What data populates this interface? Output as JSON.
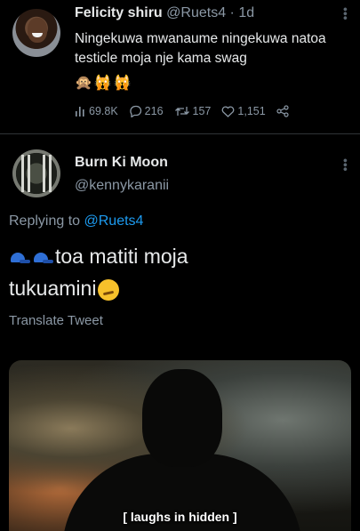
{
  "original_tweet": {
    "name": "Felicity shiru",
    "handle": "@Ruets4",
    "time": "· 1d",
    "text": "Ningekuwa mwanaume ningekuwa natoa testicle moja nje kama swag",
    "emojis": "🙊🙀🙀",
    "stats": {
      "views": "69.8K",
      "replies": "216",
      "retweets": "157",
      "likes": "1,151"
    }
  },
  "reply_tweet": {
    "name": "Burn Ki Moon",
    "handle": "@kennykaranii",
    "replying_prefix": "Replying to",
    "replying_to": "@Ruets4",
    "text_part1": "toa matiti moja",
    "text_part2": "tukuamini",
    "translate_label": "Translate Tweet"
  },
  "media": {
    "caption": "[ laughs in hidden ]"
  },
  "icons": [
    "views-icon",
    "reply-icon",
    "retweet-icon",
    "like-icon",
    "share-icon",
    "more-icon",
    "cap-emoji-icon",
    "smirk-emoji-icon"
  ]
}
